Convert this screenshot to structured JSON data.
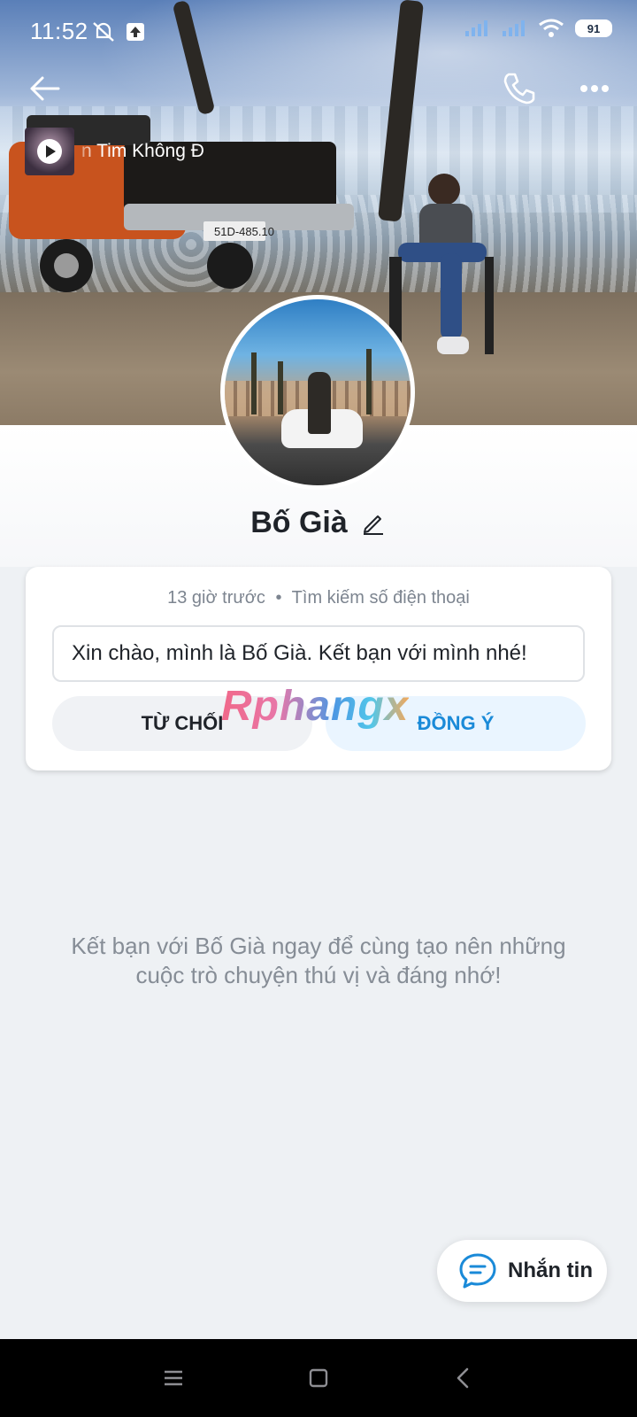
{
  "status_bar": {
    "time": "11:52",
    "battery_level": "91",
    "icons_left": [
      "mute-notifications-icon",
      "upload-icon"
    ],
    "icons_right": [
      "signal-icon",
      "signal-icon",
      "wifi-icon",
      "battery-icon"
    ]
  },
  "header": {
    "back_icon": "back-arrow-icon",
    "call_icon": "phone-icon",
    "more_icon": "more-dots-icon"
  },
  "music": {
    "title": "n Tim Không Đ",
    "thumb_icon": "play-icon"
  },
  "profile": {
    "name": "Bố Già",
    "edit_icon": "pencil-icon"
  },
  "friend_request": {
    "time": "13 giờ trước",
    "separator": "•",
    "source": "Tìm kiếm số điện thoại",
    "message": "Xin chào, mình là Bố Già. Kết bạn với mình nhé!",
    "decline_label": "TỪ CHỐI",
    "accept_label": "ĐỒNG Ý"
  },
  "watermark": "Rphangx",
  "invite_text_line1": "Kết bạn với Bố Già ngay để cùng tạo nên những",
  "invite_text_line2": "cuộc trò chuyện thú vị và đáng nhớ!",
  "message_button": {
    "label": "Nhắn tin",
    "icon": "chat-bubble-icon"
  },
  "colors": {
    "accent": "#1a8ad8",
    "accept_bg": "#eaf5ff",
    "decline_bg": "#f0f2f5",
    "page_bg": "#eef1f4"
  },
  "nav": {
    "menu_icon": "menu-icon",
    "home_icon": "home-square-icon",
    "back_icon": "back-chevron-icon"
  }
}
